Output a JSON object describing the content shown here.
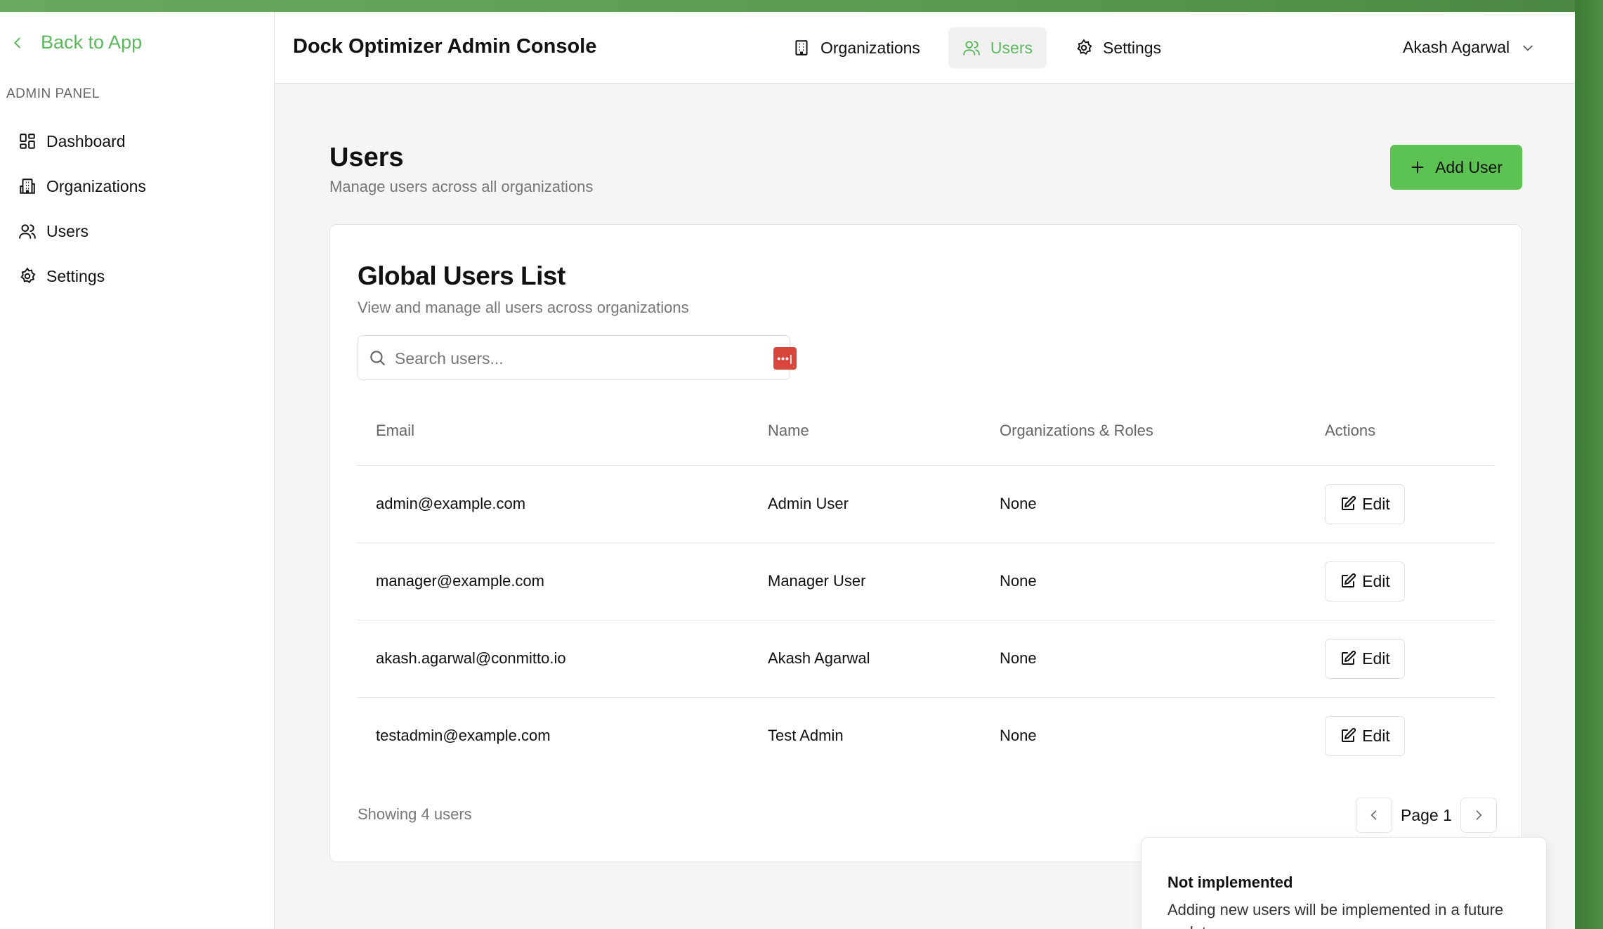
{
  "colors": {
    "accent": "#5cb85c",
    "add_button": "#5cc352",
    "window_bg": "#f5f5f5"
  },
  "sidebar": {
    "back_label": "Back to App",
    "section_label": "ADMIN PANEL",
    "items": [
      {
        "label": "Dashboard",
        "icon": "dashboard-icon"
      },
      {
        "label": "Organizations",
        "icon": "building-icon"
      },
      {
        "label": "Users",
        "icon": "users-icon"
      },
      {
        "label": "Settings",
        "icon": "gear-icon"
      }
    ]
  },
  "header": {
    "title": "Dock Optimizer Admin Console",
    "nav": [
      {
        "label": "Organizations",
        "icon": "building-icon",
        "active": false
      },
      {
        "label": "Users",
        "icon": "users-icon",
        "active": true
      },
      {
        "label": "Settings",
        "icon": "gear-icon",
        "active": false
      }
    ],
    "user_name": "Akash Agarwal"
  },
  "page": {
    "title": "Users",
    "subtitle": "Manage users across all organizations",
    "add_button_label": "Add User"
  },
  "card": {
    "title": "Global Users List",
    "subtitle": "View and manage all users across organizations",
    "search_placeholder": "Search users...",
    "password_badge": "•••|",
    "columns": [
      "Email",
      "Name",
      "Organizations & Roles",
      "Actions"
    ],
    "rows": [
      {
        "email": "admin@example.com",
        "name": "Admin User",
        "orgs": "None",
        "action": "Edit"
      },
      {
        "email": "manager@example.com",
        "name": "Manager User",
        "orgs": "None",
        "action": "Edit"
      },
      {
        "email": "akash.agarwal@conmitto.io",
        "name": "Akash Agarwal",
        "orgs": "None",
        "action": "Edit"
      },
      {
        "email": "testadmin@example.com",
        "name": "Test Admin",
        "orgs": "None",
        "action": "Edit"
      }
    ],
    "showing_text": "Showing 4 users",
    "page_label": "Page 1"
  },
  "toast": {
    "title": "Not implemented",
    "message": "Adding new users will be implemented in a future update."
  }
}
